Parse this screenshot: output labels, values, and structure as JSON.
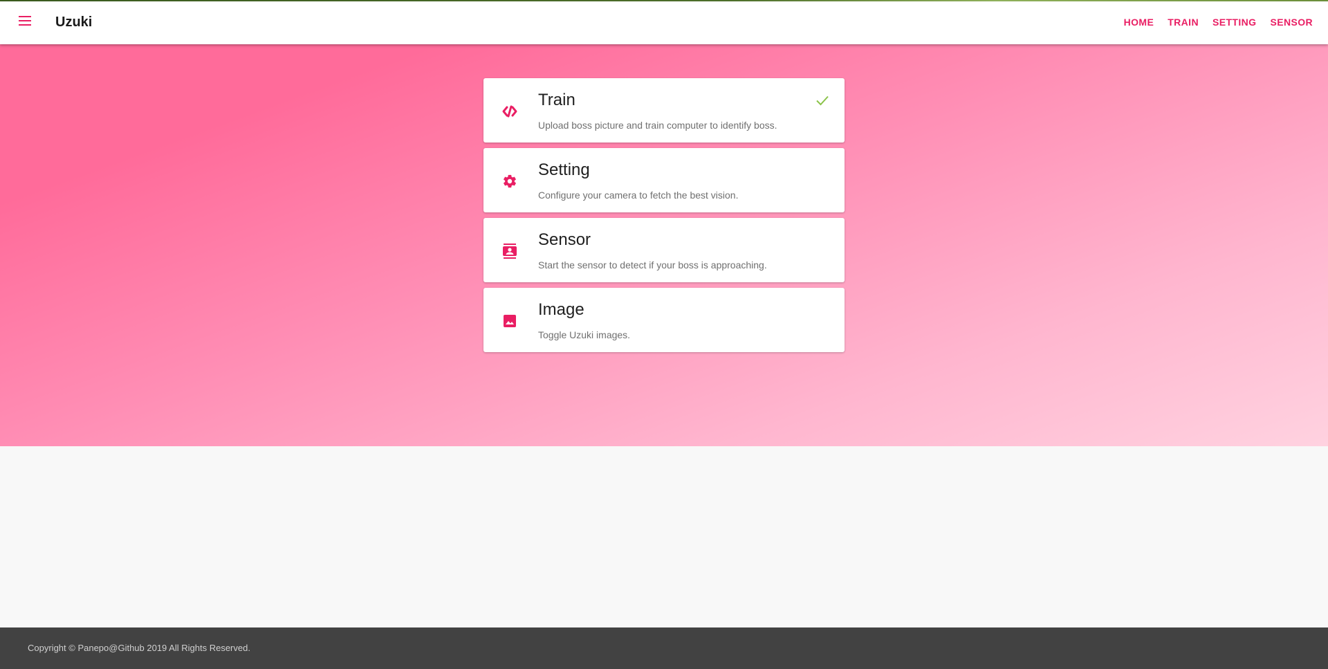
{
  "header": {
    "app_title": "Uzuki",
    "menu_icon": "hamburger-menu-icon",
    "nav": [
      "HOME",
      "TRAIN",
      "SETTING",
      "SENSOR"
    ]
  },
  "colors": {
    "accent": "#e91e63",
    "check": "#8bc34a",
    "footer_bg": "#424242",
    "hero_gradient_start": "#ff6b9a",
    "hero_gradient_end": "#ffd2e0"
  },
  "cards": [
    {
      "title": "Train",
      "description": "Upload boss picture and train computer to identify boss.",
      "icon": "code-slash-icon",
      "checked": true
    },
    {
      "title": "Setting",
      "description": "Configure your camera to fetch the best vision.",
      "icon": "gear-icon",
      "checked": false
    },
    {
      "title": "Sensor",
      "description": "Start the sensor to detect if your boss is approaching.",
      "icon": "contacts-icon",
      "checked": false
    },
    {
      "title": "Image",
      "description": "Toggle Uzuki images.",
      "icon": "image-icon",
      "checked": false
    }
  ],
  "footer": {
    "copyright": "Copyright © Panepo@Github 2019 All Rights Reserved."
  }
}
